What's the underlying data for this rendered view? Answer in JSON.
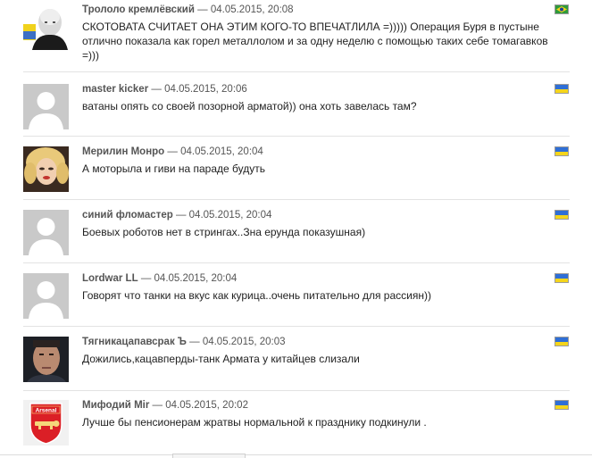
{
  "comments": [
    {
      "author": "Трололо кремлёвский",
      "separator": "—",
      "date": "04.05.2015, 20:08",
      "text": "СКОТОВАТА СЧИТАЕТ ОНА ЭТИМ КОГО-ТО ВПЕЧАТЛИЛА =))))) Операция Буря в пустыне отлично показала как горел металлолом и за одну неделю с помощью таких себе томагавков =)))",
      "avatar": "bald-man-photo",
      "flag": "brazil-flag-icon"
    },
    {
      "author": "master kicker",
      "separator": "—",
      "date": "04.05.2015, 20:06",
      "text": "ватаны опять со своей позорной арматой)) она хоть завелась там?",
      "avatar": "default-user-icon",
      "flag": "ukraine-flag-icon"
    },
    {
      "author": "Мерилин Монро",
      "separator": "—",
      "date": "04.05.2015, 20:04",
      "text": "А моторыла и гиви на параде будуть",
      "avatar": "blonde-woman-photo",
      "flag": "ukraine-flag-icon"
    },
    {
      "author": "синий фломастер",
      "separator": "—",
      "date": "04.05.2015, 20:04",
      "text": "Боевых роботов нет в стрингах..Зна ерунда показушная)",
      "avatar": "default-user-icon",
      "flag": "ukraine-flag-icon"
    },
    {
      "author": "Lordwar LL",
      "separator": "—",
      "date": "04.05.2015, 20:04",
      "text": "Говорят что танки на вкус как курица..очень питательно для рассиян))",
      "avatar": "default-user-icon",
      "flag": "ukraine-flag-icon"
    },
    {
      "author": "Тягникацапавсрак Ъ",
      "separator": "—",
      "date": "04.05.2015, 20:03",
      "text": "Дожились,кацавперды-танк Армата у китайцев слизали",
      "avatar": "man-portrait-photo",
      "flag": "ukraine-flag-icon"
    },
    {
      "author": "Мифодий Mir",
      "separator": "—",
      "date": "04.05.2015, 20:02",
      "text": "Лучше бы пенсионерам жратвы нормальной к празднику подкинули .",
      "avatar": "arsenal-crest",
      "avatar_label": "Arsenal",
      "flag": "ukraine-flag-icon"
    }
  ],
  "colors": {
    "author": "#555555",
    "text": "#222222",
    "divider": "#e3e3e3",
    "ukraine_blue": "#2f6fd6",
    "ukraine_yellow": "#f5d51a",
    "brazil_green": "#2e9a3b",
    "arsenal_red": "#db1f26"
  }
}
